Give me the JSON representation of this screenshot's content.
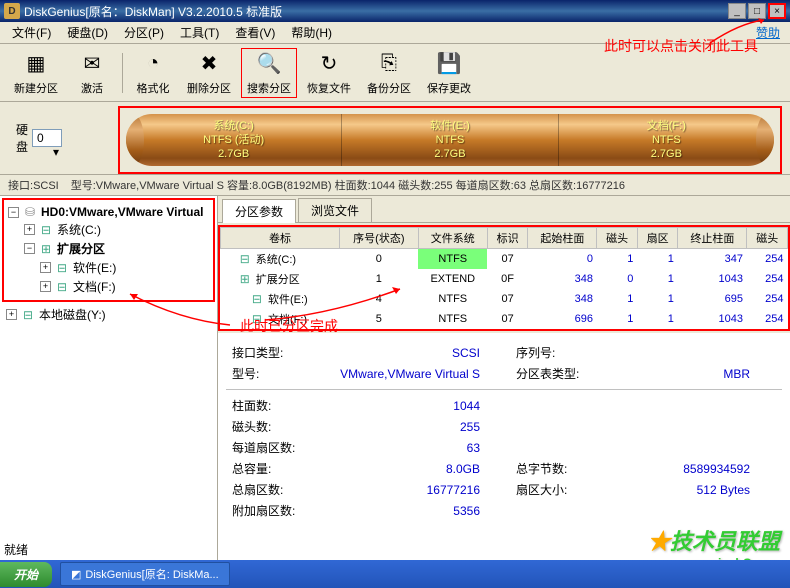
{
  "title": "DiskGenius[原名：DiskMan] V3.2.2010.5 标准版",
  "sponsor_link": "赞助",
  "menu": [
    "文件(F)",
    "硬盘(D)",
    "分区(P)",
    "工具(T)",
    "查看(V)",
    "帮助(H)"
  ],
  "toolbar": [
    {
      "label": "新建分区",
      "icon": "▦"
    },
    {
      "label": "激活",
      "icon": "✉"
    },
    {
      "label": "格式化",
      "icon": "◔"
    },
    {
      "label": "删除分区",
      "icon": "✖"
    },
    {
      "label": "搜索分区",
      "icon": "🔍",
      "hl": true
    },
    {
      "label": "恢复文件",
      "icon": "↻"
    },
    {
      "label": "备份分区",
      "icon": "⎘"
    },
    {
      "label": "保存更改",
      "icon": "💾"
    }
  ],
  "disk_label": "硬盘",
  "disk_combo": "0",
  "interface_label": "接口:",
  "interface_val": "SCSI",
  "status_strip": "型号:VMware,VMware Virtual S  容量:8.0GB(8192MB)  柱面数:1044  磁头数:255  每道扇区数:63  总扇区数:16777216",
  "partitions_cyl": [
    {
      "name": "系统(C:)",
      "fs": "NTFS (活动)",
      "size": "2.7GB"
    },
    {
      "name": "软件(E:)",
      "fs": "NTFS",
      "size": "2.7GB"
    },
    {
      "name": "文档(F:)",
      "fs": "NTFS",
      "size": "2.7GB"
    }
  ],
  "tree": {
    "root": "HD0:VMware,VMware Virtual",
    "c": "系统(C:)",
    "ext": "扩展分区",
    "e": "软件(E:)",
    "f": "文档(F:)",
    "local": "本地磁盘(Y:)"
  },
  "tabs": [
    "分区参数",
    "浏览文件"
  ],
  "table": {
    "headers": [
      "卷标",
      "序号(状态)",
      "文件系统",
      "标识",
      "起始柱面",
      "磁头",
      "扇区",
      "终止柱面",
      "磁头"
    ],
    "rows": [
      {
        "name": "系统(C:)",
        "ind": 1,
        "idx": "0",
        "fs": "NTFS",
        "fshl": true,
        "flag": "07",
        "scyl": "0",
        "hd": "1",
        "sec": "1",
        "ecyl": "347",
        "ehd": "254"
      },
      {
        "name": "扩展分区",
        "ind": 1,
        "ext": true,
        "idx": "1",
        "fs": "EXTEND",
        "flag": "0F",
        "scyl": "348",
        "hd": "0",
        "sec": "1",
        "ecyl": "1043",
        "ehd": "254"
      },
      {
        "name": "软件(E:)",
        "ind": 2,
        "idx": "4",
        "fs": "NTFS",
        "flag": "07",
        "scyl": "348",
        "hd": "1",
        "sec": "1",
        "ecyl": "695",
        "ehd": "254"
      },
      {
        "name": "文档(F:)",
        "ind": 2,
        "idx": "5",
        "fs": "NTFS",
        "flag": "07",
        "scyl": "696",
        "hd": "1",
        "sec": "1",
        "ecyl": "1043",
        "ehd": "254"
      }
    ]
  },
  "info": {
    "rows1": [
      [
        "接口类型:",
        "SCSI",
        "序列号:",
        ""
      ],
      [
        "型号:",
        "VMware,VMware Virtual S",
        "分区表类型:",
        "MBR"
      ]
    ],
    "rows2": [
      [
        "柱面数:",
        "1044",
        "",
        ""
      ],
      [
        "磁头数:",
        "255",
        "",
        ""
      ],
      [
        "每道扇区数:",
        "63",
        "",
        ""
      ],
      [
        "总容量:",
        "8.0GB",
        "总字节数:",
        "8589934592"
      ],
      [
        "总扇区数:",
        "16777216",
        "扇区大小:",
        "512 Bytes"
      ],
      [
        "附加扇区数:",
        "5356",
        "",
        ""
      ]
    ]
  },
  "annotations": {
    "close_note": "此时可以点击关闭此工具",
    "done_note": "此时已分区完成"
  },
  "watermark": {
    "text": "技术员联盟",
    "url": "www.jsghO.com"
  },
  "taskbar": {
    "start": "开始",
    "task": "DiskGenius[原名: DiskMa..."
  },
  "bottom_status": "就绪"
}
